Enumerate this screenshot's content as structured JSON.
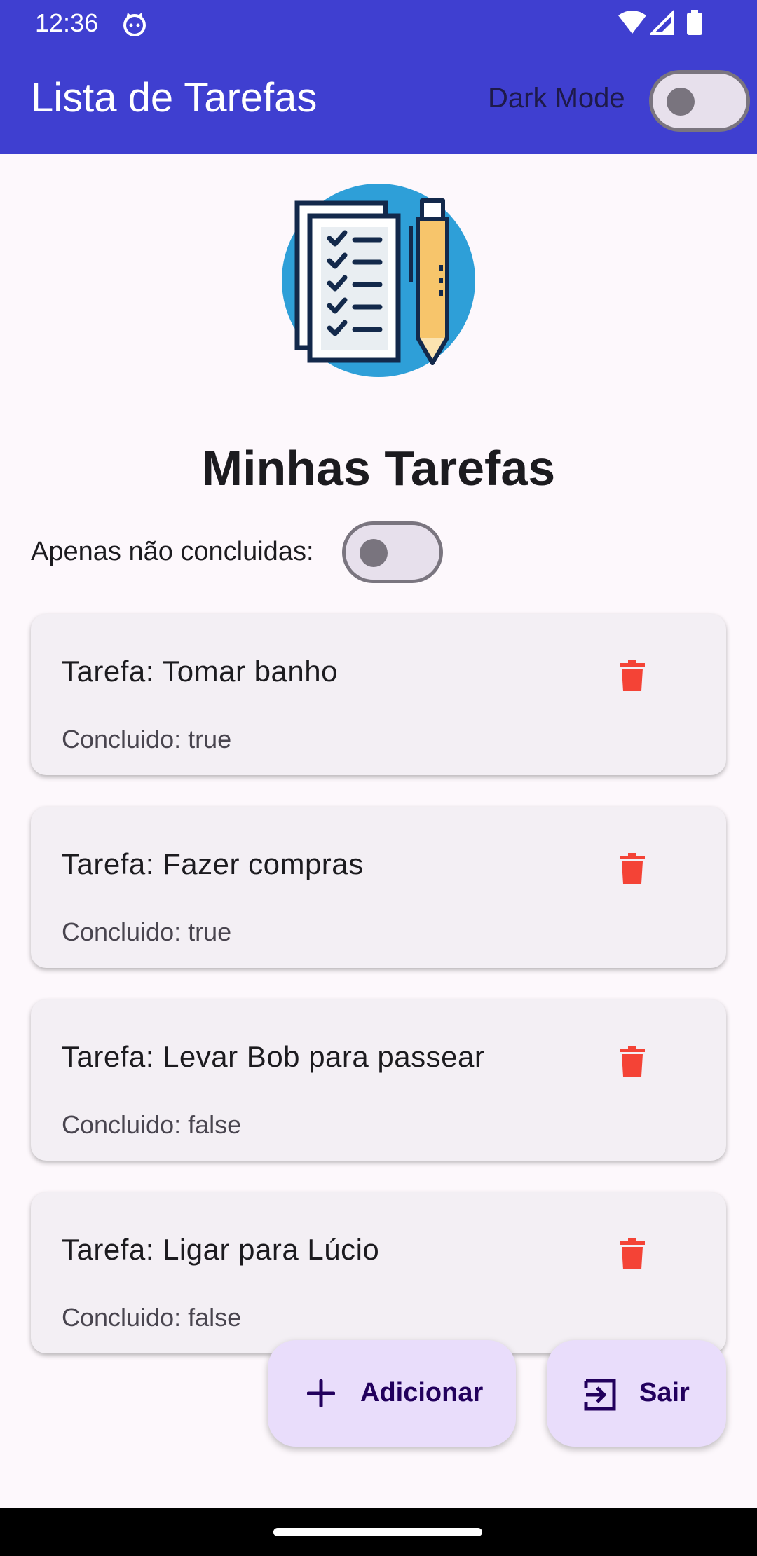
{
  "status_bar": {
    "time": "12:36"
  },
  "app_bar": {
    "title": "Lista de Tarefas",
    "dark_mode_label": "Dark Mode",
    "dark_mode_on": false
  },
  "main": {
    "heading": "Minhas Tarefas",
    "filter_label": "Apenas não concluidas:",
    "filter_on": false,
    "tasks": [
      {
        "title": "Tarefa: Tomar banho",
        "status": "Concluido: true"
      },
      {
        "title": "Tarefa: Fazer compras",
        "status": "Concluido: true"
      },
      {
        "title": "Tarefa: Levar Bob para passear",
        "status": "Concluido: false"
      },
      {
        "title": "Tarefa: Ligar para Lúcio",
        "status": "Concluido: false"
      }
    ]
  },
  "actions": {
    "add_label": "Adicionar",
    "exit_label": "Sair"
  },
  "colors": {
    "primary": "#3f3fd0",
    "delete": "#f44336",
    "fab": "#e9ddfb",
    "card": "#f3eff4"
  },
  "icons": [
    "cat-icon",
    "wifi-icon",
    "signal-icon",
    "battery-icon",
    "checklist-logo",
    "trash-icon",
    "plus-icon",
    "exit-icon"
  ]
}
